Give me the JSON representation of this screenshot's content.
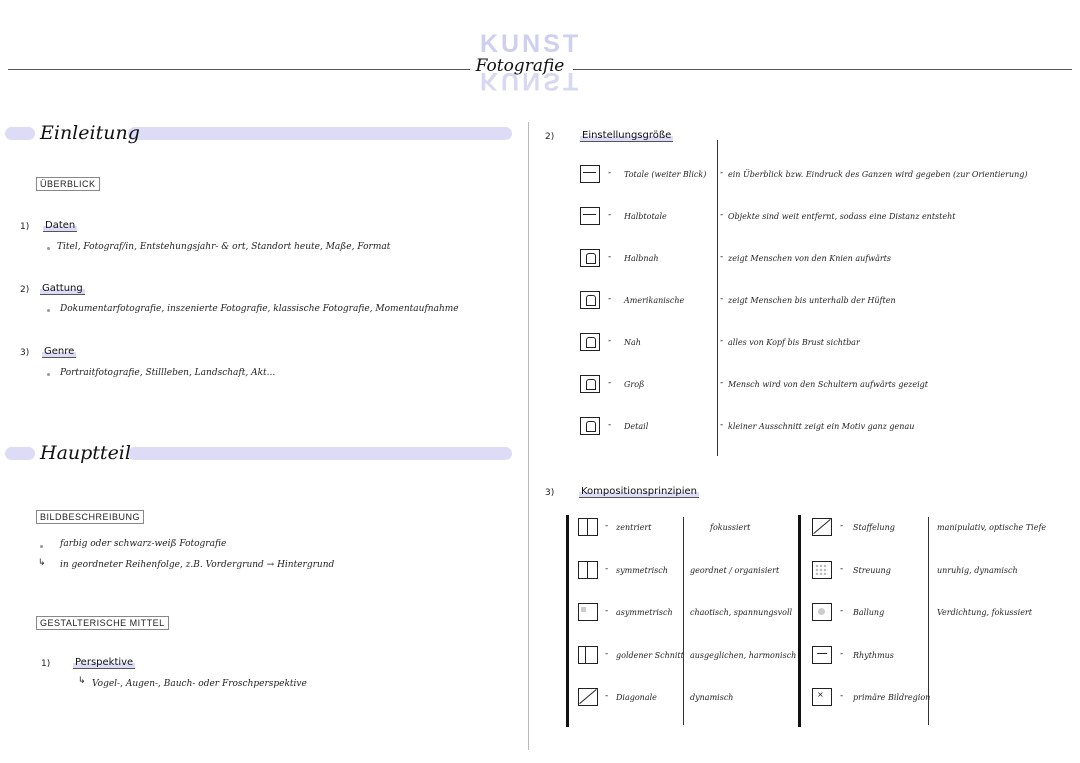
{
  "header": {
    "subject_top": "KUNST",
    "subject_bottom": "KUNST",
    "title": "Fotografie"
  },
  "left": {
    "einleitung": {
      "title": "Einleitung",
      "box": "ÜBERBLICK",
      "items": [
        {
          "num": "1)",
          "head": "Daten",
          "text": "Titel, Fotograf/in, Entstehungsjahr- & ort, Standort heute, Maße, Format"
        },
        {
          "num": "2)",
          "head": "Gattung",
          "text": "Dokumentarfotografie, inszenierte Fotografie, klassische Fotografie, Momentaufnahme"
        },
        {
          "num": "3)",
          "head": "Genre",
          "text": "Portraitfotografie, Stillleben, Landschaft, Akt..."
        }
      ]
    },
    "hauptteil": {
      "title": "Hauptteil",
      "box1": "BILDBESCHREIBUNG",
      "line1": "farbig oder schwarz-weiß Fotografie",
      "line2": "in geordneter Reihenfolge, z.B. Vordergrund → Hintergrund",
      "box2": "GESTALTERISCHE MITTEL",
      "item_num": "1)",
      "item_head": "Perspektive",
      "item_text": "Vogel-, Augen-, Bauch- oder Froschperspektive"
    }
  },
  "right": {
    "einstellung": {
      "num": "2)",
      "title": "Einstellungsgröße",
      "rows": [
        {
          "label": "Totale (weiter Blick)",
          "desc": "ein Überblick bzw. Eindruck des Ganzen wird gegeben (zur Orientierung)",
          "icon": "totale-icon"
        },
        {
          "label": "Halbtotale",
          "desc": "Objekte sind weit entfernt, sodass eine Distanz entsteht",
          "icon": "halbtotale-icon"
        },
        {
          "label": "Halbnah",
          "desc": "zeigt Menschen von den Knien aufwärts",
          "icon": "halbnah-icon"
        },
        {
          "label": "Amerikanische",
          "desc": "zeigt Menschen bis unterhalb der Hüften",
          "icon": "amerikanische-icon"
        },
        {
          "label": "Nah",
          "desc": "alles von Kopf bis Brust sichtbar",
          "icon": "nah-icon"
        },
        {
          "label": "Groß",
          "desc": "Mensch wird von den Schultern aufwärts gezeigt",
          "icon": "gross-icon"
        },
        {
          "label": "Detail",
          "desc": "kleiner Ausschnitt zeigt ein Motiv ganz genau",
          "icon": "detail-icon"
        }
      ]
    },
    "komposition": {
      "num": "3)",
      "title": "Kompositionsprinzipien",
      "left_rows": [
        {
          "label": "zentriert",
          "effect": "fokussiert",
          "icon": "zentriert-icon"
        },
        {
          "label": "symmetrisch",
          "effect": "geordnet / organisiert",
          "icon": "symmetrisch-icon"
        },
        {
          "label": "asymmetrisch",
          "effect": "chaotisch, spannungsvoll",
          "icon": "asymmetrisch-icon"
        },
        {
          "label": "goldener Schnitt",
          "effect": "ausgeglichen, harmonisch",
          "icon": "goldener-schnitt-icon"
        },
        {
          "label": "Diagonale",
          "effect": "dynamisch",
          "icon": "diagonale-icon"
        }
      ],
      "right_rows": [
        {
          "label": "Staffelung",
          "effect": "manipulativ, optische Tiefe",
          "icon": "staffelung-icon"
        },
        {
          "label": "Streuung",
          "effect": "unruhig, dynamisch",
          "icon": "streuung-icon"
        },
        {
          "label": "Ballung",
          "effect": "Verdichtung, fokussiert",
          "icon": "ballung-icon"
        },
        {
          "label": "Rhythmus",
          "effect": "",
          "icon": "rhythmus-icon"
        },
        {
          "label": "primäre Bildregion",
          "effect": "",
          "icon": "primaere-bildregion-icon"
        }
      ]
    }
  }
}
